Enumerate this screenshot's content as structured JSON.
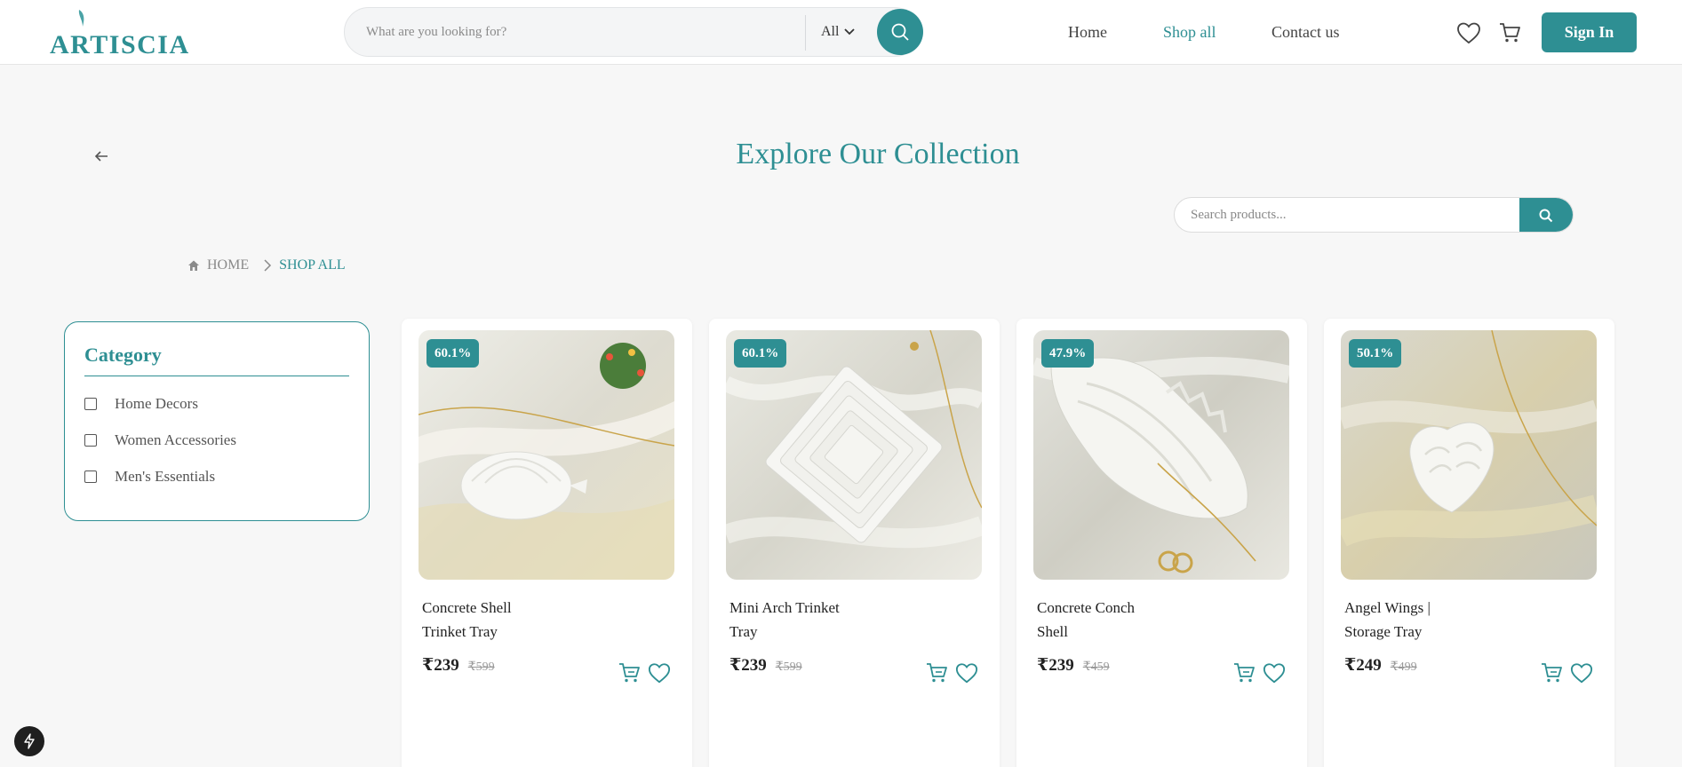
{
  "header": {
    "logo": "ARTISCIA",
    "search_placeholder": "What are you looking for?",
    "category_select": "All",
    "nav": {
      "home": "Home",
      "shop_all": "Shop all",
      "contact": "Contact us"
    },
    "sign_in": "Sign In"
  },
  "hero": {
    "title": "Explore Our Collection",
    "search_placeholder": "Search products..."
  },
  "breadcrumb": {
    "home": "HOME",
    "current": "SHOP ALL"
  },
  "sidebar": {
    "title": "Category",
    "categories": [
      "Home Decors",
      "Women Accessories",
      "Men's Essentials"
    ]
  },
  "products": [
    {
      "name": "Concrete Shell Trinket Tray",
      "discount": "60.1%",
      "price": "₹239",
      "old_price": "₹599"
    },
    {
      "name": "Mini Arch Trinket Tray",
      "discount": "60.1%",
      "price": "₹239",
      "old_price": "₹599"
    },
    {
      "name": "Concrete Conch Shell",
      "discount": "47.9%",
      "price": "₹239",
      "old_price": "₹459"
    },
    {
      "name": "Angel Wings | Storage Tray",
      "discount": "50.1%",
      "price": "₹249",
      "old_price": "₹499"
    }
  ],
  "colors": {
    "accent": "#2e8f93",
    "background": "#f7f7f7"
  },
  "icons": [
    "search-icon",
    "chevron-down-icon",
    "heart-icon",
    "cart-icon",
    "back-arrow-icon",
    "home-icon",
    "chevron-right-icon",
    "bolt-icon"
  ]
}
